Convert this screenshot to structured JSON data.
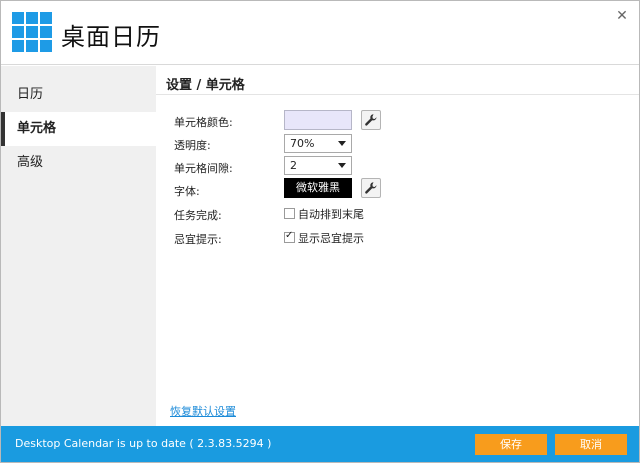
{
  "app": {
    "title": "桌面日历"
  },
  "sidebar": {
    "items": [
      {
        "label": "日历",
        "active": false
      },
      {
        "label": "单元格",
        "active": true
      },
      {
        "label": "高级",
        "active": false
      }
    ]
  },
  "main": {
    "breadcrumb": "设置 / 单元格",
    "cell_color": {
      "label": "单元格颜色:",
      "value": "#e8e6fa"
    },
    "opacity": {
      "label": "透明度:",
      "value": "70%"
    },
    "spacing": {
      "label": "单元格间隙:",
      "value": "2"
    },
    "font": {
      "label": "字体:",
      "value": "微软雅黑"
    },
    "task_done": {
      "label": "任务完成:",
      "option": "自动排到末尾",
      "checked": false
    },
    "taboo_tip": {
      "label": "忌宜提示:",
      "option": "显示忌宜提示",
      "checked": true
    },
    "reset_link": "恢复默认设置"
  },
  "footer": {
    "status": "Desktop Calendar is up to date ( 2.3.83.5294 )",
    "save_label": "保存",
    "cancel_label": "取消"
  },
  "icons": {
    "close": "close-icon",
    "tool": "wrench-icon",
    "dropdown": "chevron-down-icon"
  },
  "colors": {
    "accent": "#1a9be0",
    "button": "#f89c1c",
    "logo": "#1e9be6"
  }
}
